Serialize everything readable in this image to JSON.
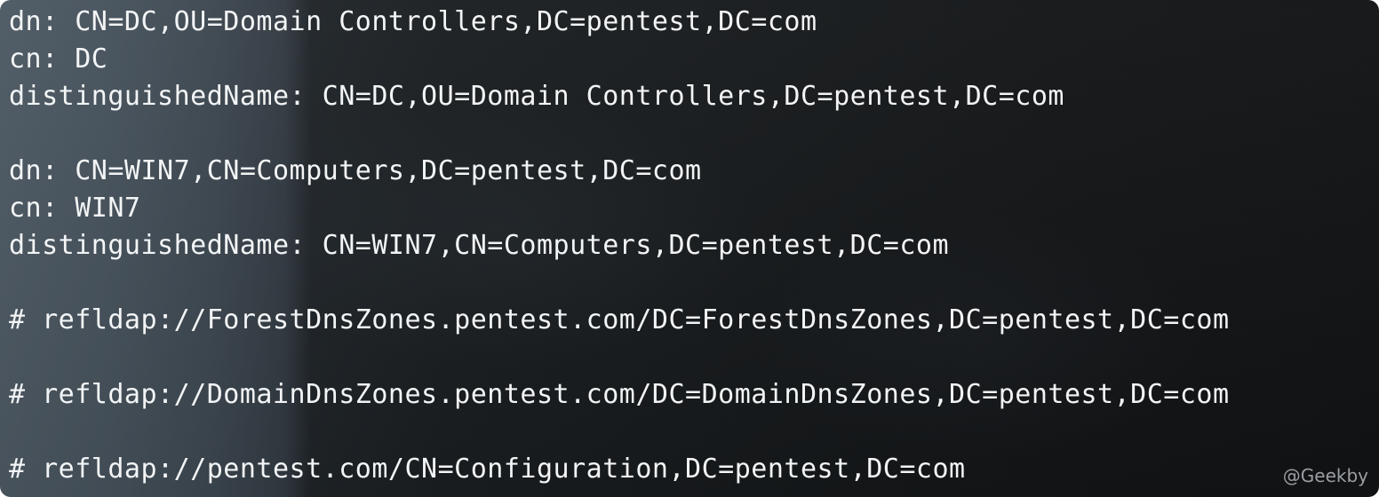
{
  "terminal": {
    "lines": [
      "dn: CN=DC,OU=Domain Controllers,DC=pentest,DC=com",
      "cn: DC",
      "distinguishedName: CN=DC,OU=Domain Controllers,DC=pentest,DC=com",
      "",
      "dn: CN=WIN7,CN=Computers,DC=pentest,DC=com",
      "cn: WIN7",
      "distinguishedName: CN=WIN7,CN=Computers,DC=pentest,DC=com",
      "",
      "# refldap://ForestDnsZones.pentest.com/DC=ForestDnsZones,DC=pentest,DC=com",
      "",
      "# refldap://DomainDnsZones.pentest.com/DC=DomainDnsZones,DC=pentest,DC=com",
      "",
      "# refldap://pentest.com/CN=Configuration,DC=pentest,DC=com"
    ]
  },
  "watermark": "@Geekby"
}
